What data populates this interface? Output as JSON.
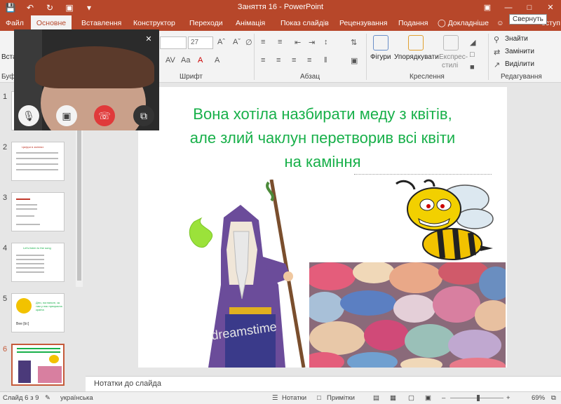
{
  "window": {
    "title": "Заняття 16 - PowerPoint",
    "collapse_tooltip": "Свернуть"
  },
  "tabs": [
    "Файл",
    "Основне",
    "Вставлення",
    "Конструктор",
    "Переходи",
    "Анімація",
    "Показ слайдів",
    "Рецензування",
    "Подання"
  ],
  "tell_me": "Докладніше",
  "share_partial": "оступ",
  "ribbon": {
    "paste_partial": "Вста",
    "buffer_partial": "Буфе",
    "font_size": "27",
    "font_group": "Шрифт",
    "paragraph_group": "Абзац",
    "shapes": "Фігури",
    "arrange": "Упорядкувати",
    "express_1": "Експрес-",
    "express_2": "стилі",
    "drawing_group": "Креслення",
    "find": "Знайти",
    "replace": "Замінити",
    "select": "Виділити",
    "editing_group": "Редагування"
  },
  "thumbnails": {
    "numbers": [
      "1",
      "2",
      "3",
      "4",
      "5",
      "6"
    ],
    "slide2_title": "Цифри в зміннях",
    "slide4_title": "Let's listen to the song",
    "slide5_text": "Діти, погляньте, як там у нас прекрасна країна",
    "slide5_word": "Bee [bi:]"
  },
  "slide": {
    "title_line1": "Вона хотіла назбирати меду з квітів,",
    "title_line2": "але злий чаклун перетворив всі квіти",
    "title_line3": "на каміння",
    "watermark": "dreamstime"
  },
  "notes_placeholder": "Нотатки до слайда",
  "status": {
    "slide_info": "Слайд 6 з 9",
    "language": "українська",
    "notes": "Нотатки",
    "comments": "Примітки",
    "zoom": "69%"
  }
}
